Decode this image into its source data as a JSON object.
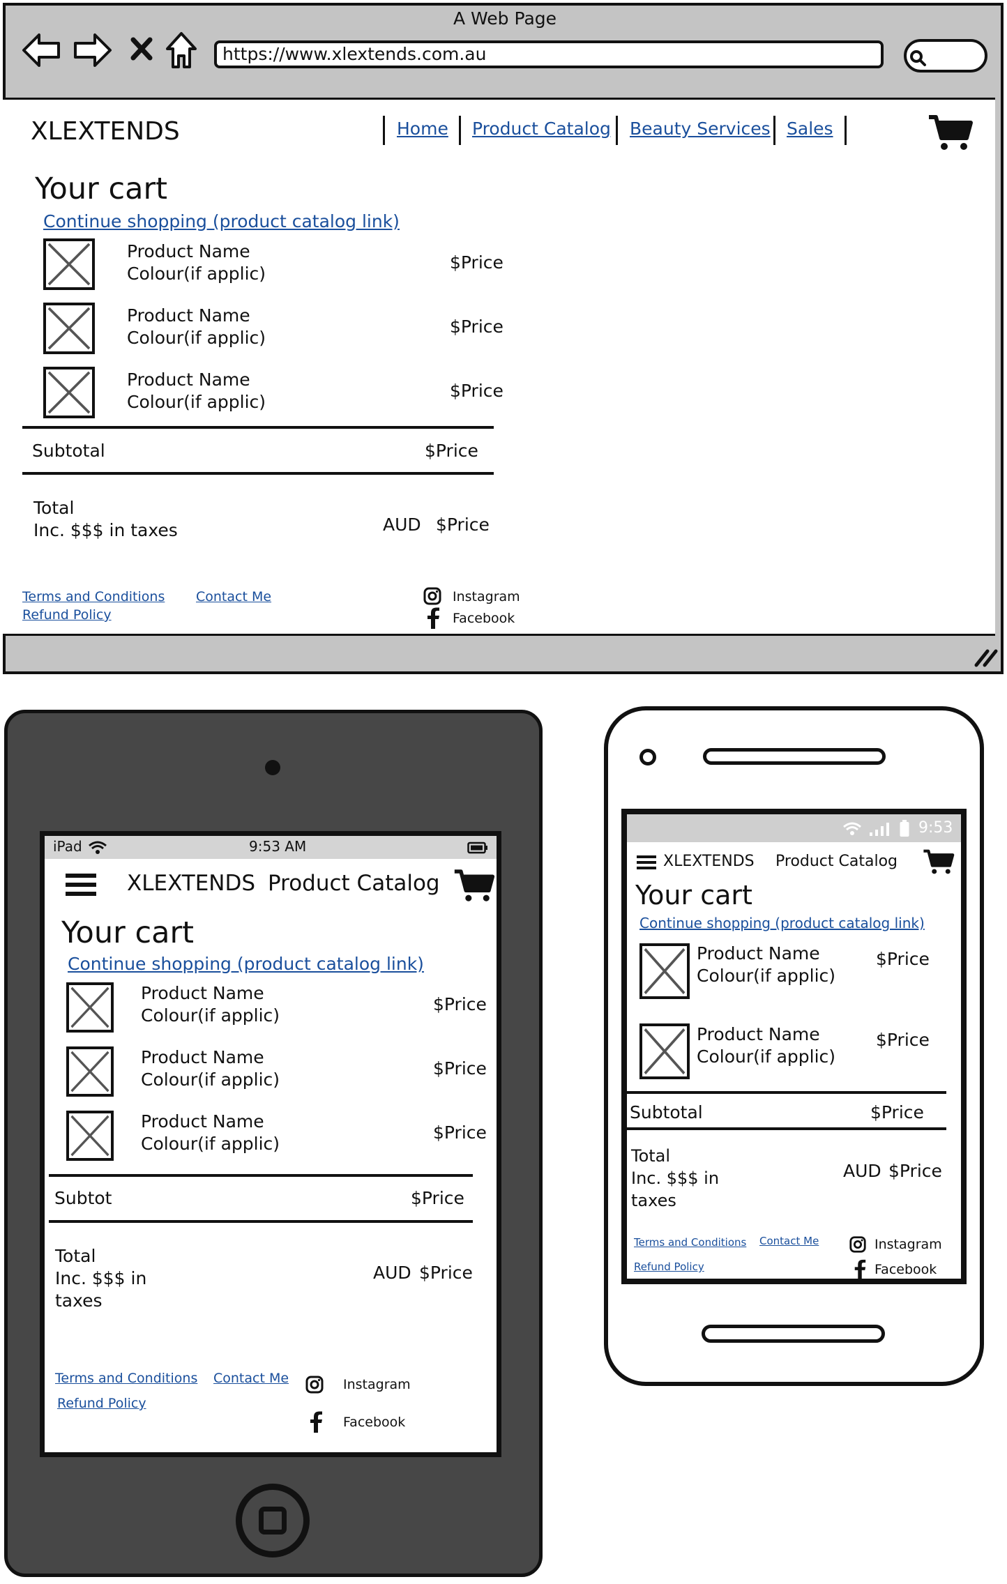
{
  "browser": {
    "window_title": "A Web Page",
    "url": "https://www.xlextends.com.au",
    "brand": "XLEXTENDS",
    "nav": [
      "Home",
      "Product Catalog",
      "Beauty Services",
      "Sales"
    ],
    "cart_title": "Your cart",
    "continue_link": "Continue shopping (product catalog link)",
    "items": [
      {
        "name": "Product Name",
        "colour": "Colour(if applic)",
        "price": "$Price"
      },
      {
        "name": "Product Name",
        "colour": "Colour(if applic)",
        "price": "$Price"
      },
      {
        "name": "Product Name",
        "colour": "Colour(if applic)",
        "price": "$Price"
      }
    ],
    "subtotal_label": "Subtotal",
    "subtotal_value": "$Price",
    "total_label": "Total",
    "total_note": "Inc. $$$ in taxes",
    "currency": "AUD",
    "total_value": "$Price",
    "footer": {
      "terms": "Terms and Conditions",
      "refund": "Refund Policy",
      "contact": "Contact Me",
      "instagram": "Instagram",
      "facebook": "Facebook"
    }
  },
  "tablet": {
    "device_label": "iPad",
    "time": "9:53 AM",
    "brand": "XLEXTENDS",
    "page_title": "Product Catalog",
    "cart_title": "Your cart",
    "continue_link": "Continue shopping (product catalog link)",
    "items": [
      {
        "name": "Product Name",
        "colour": "Colour(if applic)",
        "price": "$Price"
      },
      {
        "name": "Product Name",
        "colour": "Colour(if applic)",
        "price": "$Price"
      },
      {
        "name": "Product Name",
        "colour": "Colour(if applic)",
        "price": "$Price"
      }
    ],
    "subtotal_label": "Subtot",
    "subtotal_value": "$Price",
    "total_label": "Total",
    "total_note_1": "Inc. $$$ in",
    "total_note_2": "taxes",
    "currency": "AUD",
    "total_value": "$Price",
    "footer": {
      "terms": "Terms and Conditions",
      "refund": "Refund Policy",
      "contact": "Contact Me",
      "instagram": "Instagram",
      "facebook": "Facebook"
    }
  },
  "phone": {
    "time": "9:53",
    "brand": "XLEXTENDS",
    "page_title": "Product Catalog",
    "cart_title": "Your cart",
    "continue_link": "Continue shopping (product catalog link)",
    "items": [
      {
        "name": "Product Name",
        "colour": "Colour(if applic)",
        "price": "$Price"
      },
      {
        "name": "Product Name",
        "colour": "Colour(if applic)",
        "price": "$Price"
      }
    ],
    "subtotal_label": "Subtotal",
    "subtotal_value": "$Price",
    "total_label": "Total",
    "total_note_1": "Inc. $$$ in",
    "total_note_2": "taxes",
    "currency": "AUD",
    "total_value": "$Price",
    "footer": {
      "terms": "Terms and Conditions",
      "refund": "Refund Policy",
      "contact": "Contact Me",
      "instagram": "Instagram",
      "facebook": "Facebook"
    }
  },
  "colors": {
    "link": "#1a4f9c",
    "tablet_body": "#474747",
    "chrome": "#c4c4c4"
  }
}
